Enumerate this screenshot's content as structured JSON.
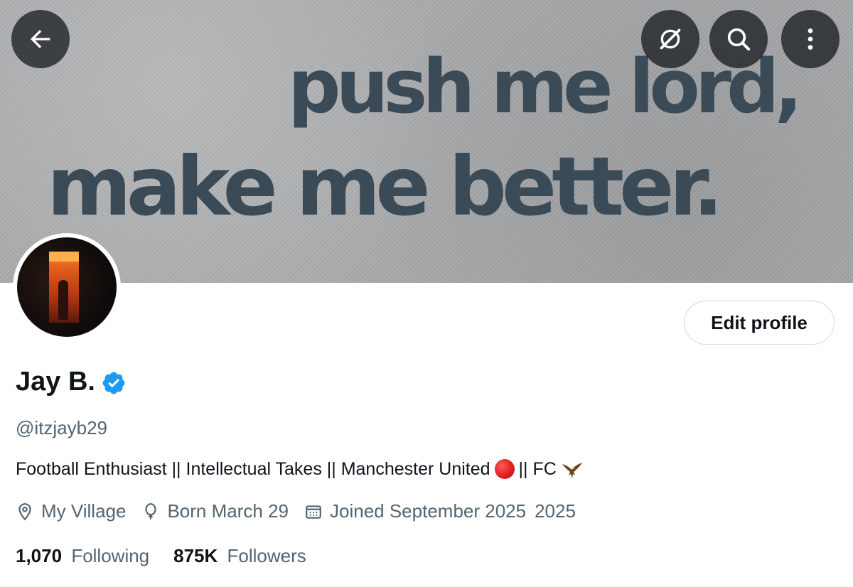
{
  "banner": {
    "line1": "push me lord,",
    "line2": "make me better."
  },
  "header_buttons": {
    "back_icon": "arrow-left-icon",
    "grok_icon": "grok-icon",
    "search_icon": "search-icon",
    "more_icon": "more-vertical-icon"
  },
  "profile": {
    "edit_label": "Edit profile",
    "display_name": "Jay B.",
    "verified": true,
    "handle": "@itzjayb29",
    "bio_part1": "Football Enthusiast || Intellectual Takes || Manchester United",
    "bio_part2": "|| FC",
    "location": "My Village",
    "birthday": "Born March 29",
    "joined": "Joined September 2025",
    "joined_extra": "2025",
    "following_count": "1,070",
    "following_label": "Following",
    "followers_count": "875K",
    "followers_label": "Followers"
  },
  "colors": {
    "accent": "#1d9bf0",
    "text_primary": "#0f1419",
    "text_secondary": "#536471",
    "border": "#cfd9de"
  }
}
